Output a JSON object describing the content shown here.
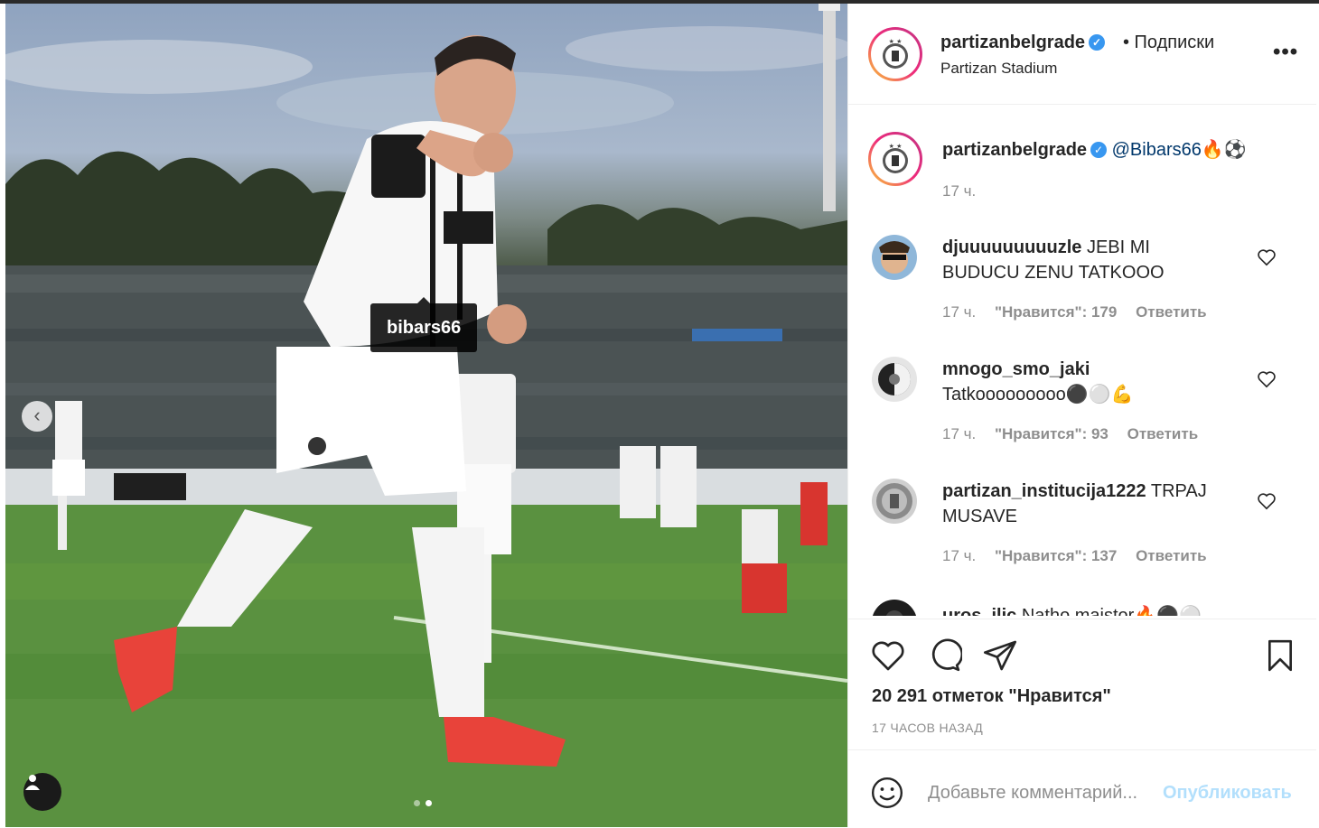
{
  "photo": {
    "tag_label": "bibars66",
    "carousel_total": 2,
    "carousel_active": 2
  },
  "post": {
    "username": "partizanbelgrade",
    "follow_label": "• Подписки",
    "location": "Partizan Stadium",
    "caption_mention": "@Bibars66",
    "caption_emoji": "🔥⚽",
    "caption_time": "17 ч."
  },
  "comments": [
    {
      "user": "djuuuuuuuuuzle",
      "text": "JEBI MI BUDUCU ZENU TATKOOO",
      "time": "17 ч.",
      "likes": "\"Нравится\": 179",
      "reply": "Ответить"
    },
    {
      "user": "mnogo_smo_jaki",
      "text": "Tatkooooooooo⚫⚪💪",
      "time": "17 ч.",
      "likes": "\"Нравится\": 93",
      "reply": "Ответить"
    },
    {
      "user": "partizan_institucija1222",
      "text": "TRPAJ MUSAVE",
      "time": "17 ч.",
      "likes": "\"Нравится\": 137",
      "reply": "Ответить"
    },
    {
      "user": "uros_ilic",
      "text": "Natho majstor🔥⚫⚪"
    }
  ],
  "footer": {
    "likes_count": "20 291 отметок \"Нравится\"",
    "time_ago": "17 ЧАСОВ НАЗАД",
    "comment_placeholder": "Добавьте комментарий...",
    "publish_label": "Опубликовать"
  },
  "colors": {
    "accent": "#3897f0",
    "mention": "#00376b",
    "publish_disabled": "#b2dffc",
    "muted": "#8e8e8e"
  }
}
